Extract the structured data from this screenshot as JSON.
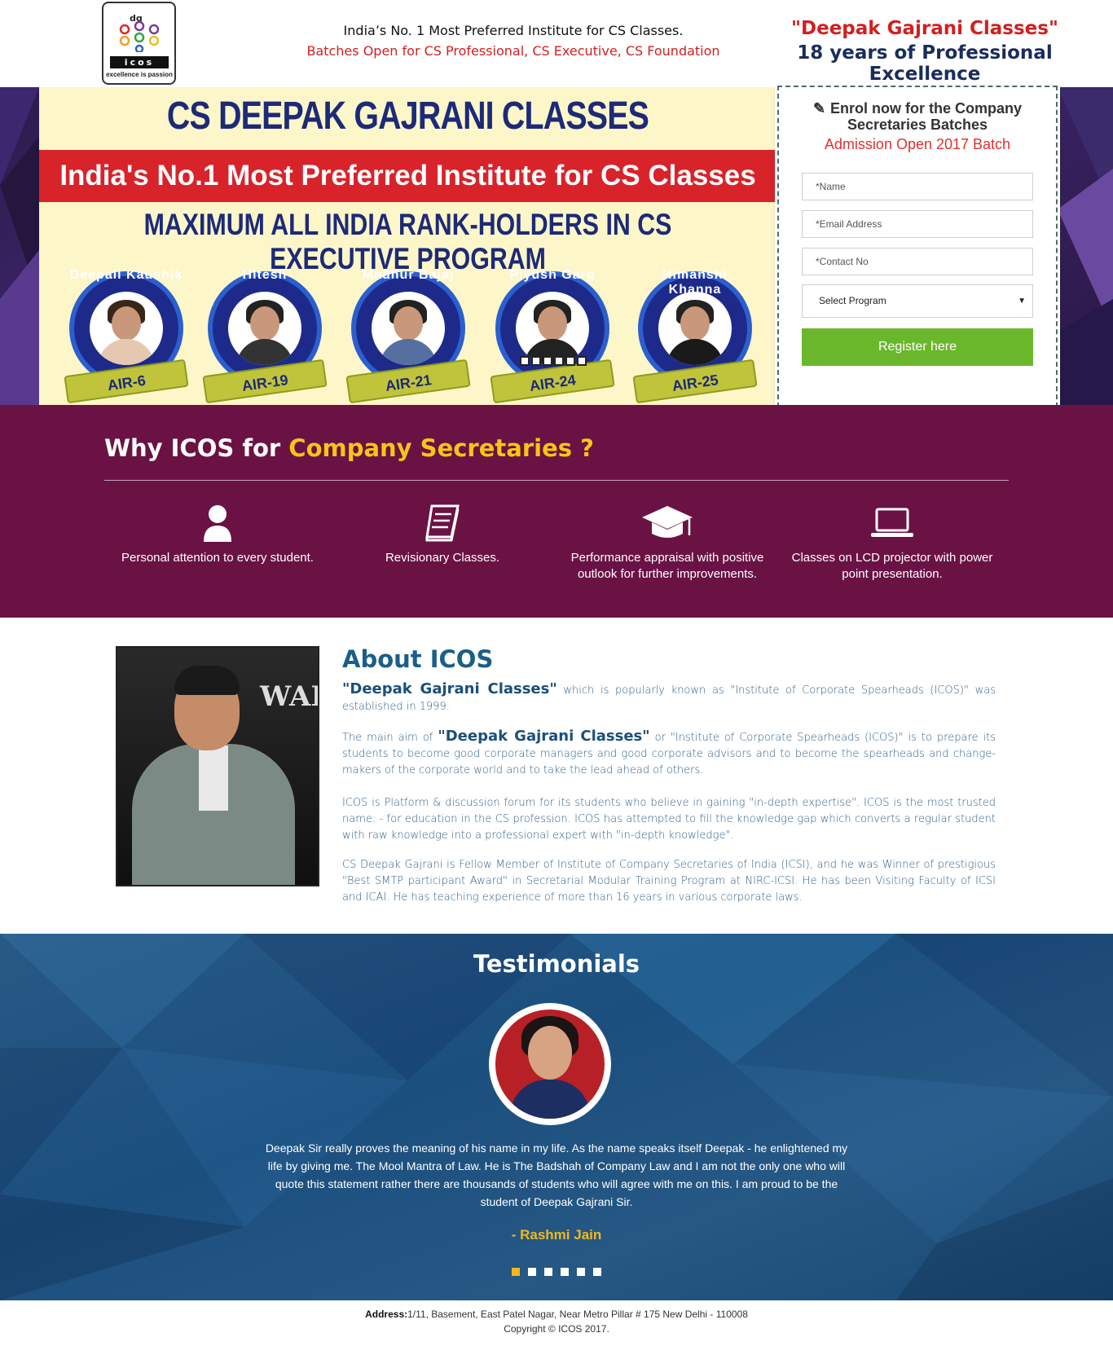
{
  "header": {
    "logo_letters": "dg",
    "logo_name": "icos",
    "logo_tagline": "excellence is passion",
    "line1": "India’s No. 1 Most Preferred Institute for CS Classes.",
    "line2": "Batches Open for CS Professional, CS Executive, CS Foundation",
    "brand": "\"Deepak Gajrani Classes\"",
    "subtitle": "18 years of Professional Excellence"
  },
  "banner": {
    "title": "CS DEEPAK GAJRANI CLASSES",
    "red_strip": "India's No.1 Most Preferred Institute for CS Classes",
    "subtitle": "MAXIMUM  ALL INDIA RANK-HOLDERS IN CS EXECUTIVE PROGRAM",
    "ranks": [
      {
        "name": "Deepali Kaushik",
        "air": "AIR-6"
      },
      {
        "name": "Hitesh",
        "air": "AIR-19"
      },
      {
        "name": "Madhur Bajaj",
        "air": "AIR-21"
      },
      {
        "name": "Piyush Garg",
        "air": "AIR-24"
      },
      {
        "name": "Himanshi Khanna",
        "air": "AIR-25"
      }
    ]
  },
  "enrol": {
    "title": "Enrol now for the Company Secretaries Batches",
    "subtitle": "Admission Open 2017 Batch",
    "name_placeholder": "*Name",
    "email_placeholder": "*Email Address",
    "contact_placeholder": "*Contact No",
    "program_select": "Select Program",
    "register_label": "Register here"
  },
  "why": {
    "title_prefix": "Why ICOS for ",
    "title_highlight": "Company Secretaries ?",
    "features": [
      {
        "icon": "user-icon",
        "text": "Personal attention to every student."
      },
      {
        "icon": "book-icon",
        "text": "Revisionary Classes."
      },
      {
        "icon": "graduation-cap-icon",
        "text": "Performance appraisal with positive outlook for further improvements."
      },
      {
        "icon": "laptop-icon",
        "text": "Classes on LCD projector with power point presentation."
      }
    ]
  },
  "about": {
    "title": "About ICOS",
    "brand": "\"Deepak Gajrani Classes\"",
    "p1_rest": " which is popularly known as \"Institute of Corporate Spearheads (ICOS)\" was established in 1999.",
    "p2_lead": "The main aim of ",
    "p2_rest": " or \"Institute of Corporate Spearheads (ICOS)\" is to prepare its students to become good corporate managers and good corporate advisors and to become the spearheads and change-makers of the corporate world and to take the lead ahead of others.",
    "p3": "ICOS is Platform & discussion forum for its students who believe in gaining \"in-depth expertise\". ICOS is the most trusted name: - for education in the CS profession. ICOS has attempted to fill the knowledge gap which converts a regular student with raw knowledge into a professional expert with \"in-depth knowledge\".",
    "p4": "CS Deepak Gajrani is Fellow Member of Institute of Company Secretaries of India (ICSI), and he was Winner of prestigious \"Best SMTP participant Award\" in Secretarial Modular Training Program at NIRC-ICSI. He has been Visiting Faculty of ICSI and ICAI. He has teaching experience of more than 16 years in various corporate laws."
  },
  "testimonials": {
    "title": "Testimonials",
    "quote": "Deepak Sir really proves the meaning of his name in my life. As the name speaks itself Deepak - he enlightened my life by giving me. The Mool Mantra of Law. He is The Badshah of Company Law and I am not the only one who will quote this statement rather there are thousands of students who will agree with me on this. I am proud to be the student of Deepak Gajrani Sir.",
    "author": "- Rashmi Jain"
  },
  "footer": {
    "address_label": "Address:",
    "address": "1/11, Basement, East Patel Nagar, Near Metro Pillar # 175 New Delhi - 110008",
    "copyright": "Copyright © ICOS 2017."
  },
  "colors": {
    "brand_red": "#d21f1f",
    "navy": "#1a2c5b",
    "why_bg": "#6b1244",
    "highlight_yellow": "#f5c518",
    "testimonial_bg": "#1b4f7e",
    "register_green": "#6ab72c"
  }
}
